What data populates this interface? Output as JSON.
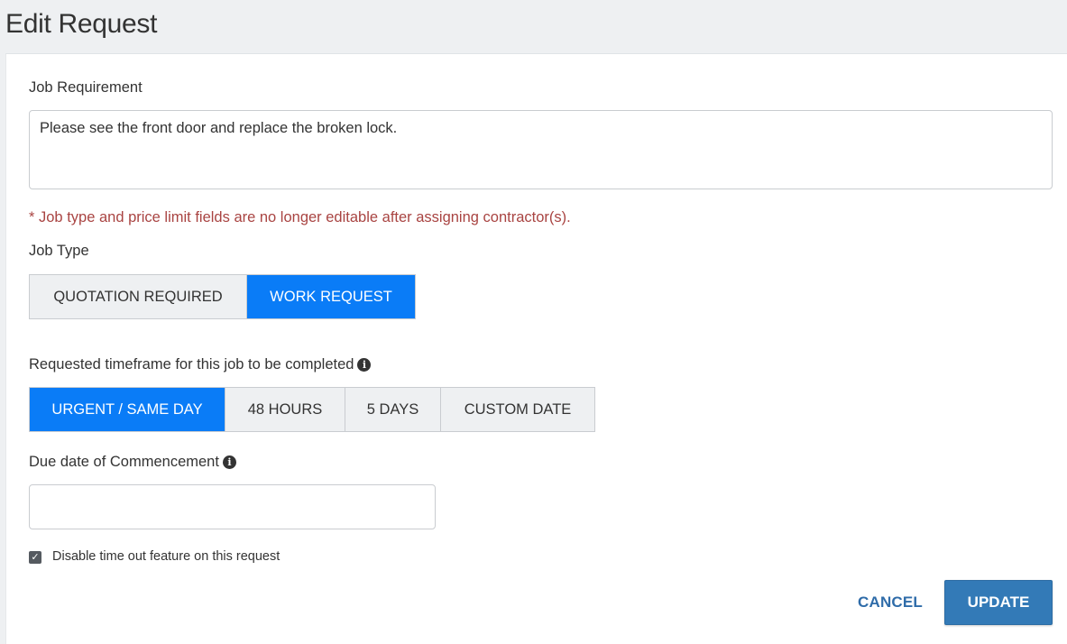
{
  "page": {
    "title": "Edit Request"
  },
  "job_requirement": {
    "label": "Job Requirement",
    "value": "Please see the front door and replace the broken lock."
  },
  "warning": "* Job type and price limit fields are no longer editable after assigning contractor(s).",
  "job_type": {
    "label": "Job Type",
    "options": [
      {
        "label": "QUOTATION REQUIRED",
        "selected": false
      },
      {
        "label": "WORK REQUEST",
        "selected": true
      }
    ]
  },
  "timeframe": {
    "label": "Requested timeframe for this job to be completed",
    "icon": "info-circle-icon",
    "options": [
      {
        "label": "URGENT / SAME DAY",
        "selected": true
      },
      {
        "label": "48 HOURS",
        "selected": false
      },
      {
        "label": "5 DAYS",
        "selected": false
      },
      {
        "label": "CUSTOM DATE",
        "selected": false
      }
    ]
  },
  "due_date": {
    "label": "Due date of Commencement",
    "icon": "info-circle-icon",
    "value": ""
  },
  "disable_timeout": {
    "label": "Disable time out feature on this request",
    "checked": true
  },
  "actions": {
    "cancel_label": "CANCEL",
    "update_label": "UPDATE"
  },
  "colors": {
    "accent": "#0a7cf7",
    "primary_button": "#337ab7",
    "warning": "#a94442",
    "link": "#2f6ca9"
  }
}
